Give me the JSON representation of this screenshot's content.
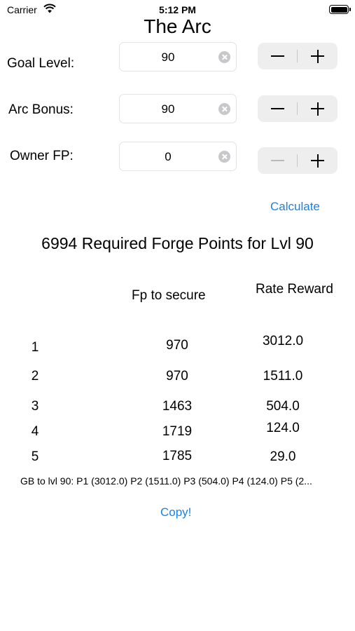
{
  "status_bar": {
    "carrier": "Carrier",
    "time": "5:12 PM"
  },
  "title": "The Arc",
  "inputs": [
    {
      "label": "Goal Level:",
      "value": "90"
    },
    {
      "label": "Arc Bonus:",
      "value": "90"
    },
    {
      "label": "Owner FP:",
      "value": "0"
    }
  ],
  "calculate_label": "Calculate",
  "result_text": "6994 Required Forge Points for Lvl 90",
  "table": {
    "headers": {
      "fp_to_secure": "Fp to secure",
      "rate_reward": "Rate Reward"
    },
    "rows": [
      {
        "rank": "1",
        "fp": "970",
        "reward": "3012.0"
      },
      {
        "rank": "2",
        "fp": "970",
        "reward": "1511.0"
      },
      {
        "rank": "3",
        "fp": "1463",
        "reward": "504.0"
      },
      {
        "rank": "4",
        "fp": "1719",
        "reward": "124.0"
      },
      {
        "rank": "5",
        "fp": "1785",
        "reward": "29.0"
      }
    ]
  },
  "summary": "GB to lvl 90: P1 (3012.0) P2 (1511.0) P3 (504.0) P4 (124.0) P5 (2...",
  "copy_label": "Copy!",
  "colors": {
    "accent": "#1a82e2",
    "stepper_bg": "#eeeeef"
  },
  "icons": {
    "wifi": "wifi-icon",
    "battery": "battery-icon",
    "clear": "clear-icon",
    "minus": "minus-icon",
    "plus": "plus-icon"
  }
}
